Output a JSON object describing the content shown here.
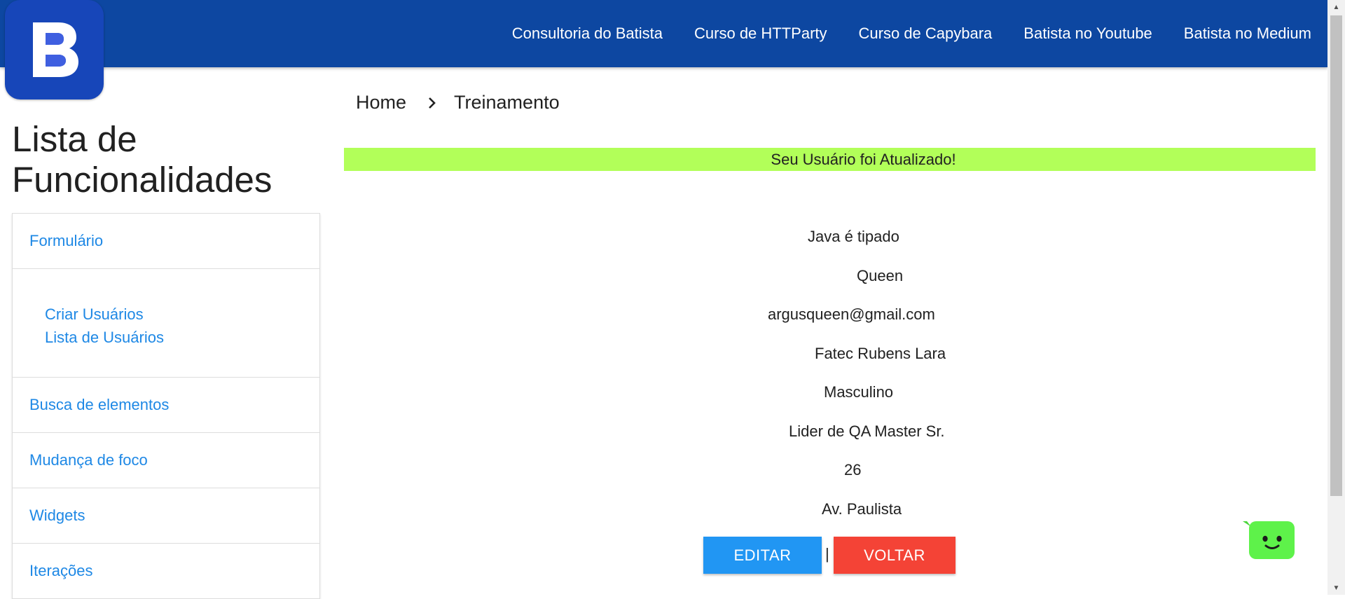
{
  "header": {
    "logo_text": "B",
    "nav_links": [
      "Consultoria do Batista",
      "Curso de HTTParty",
      "Curso de Capybara",
      "Batista no Youtube",
      "Batista no Medium"
    ]
  },
  "sidebar": {
    "title_line1": "Lista de",
    "title_line2": "Funcionalidades",
    "sections": [
      {
        "label": "Formulário",
        "items": [
          "Criar Usuários",
          "Lista de Usuários"
        ]
      },
      {
        "label": "Busca de elementos"
      },
      {
        "label": "Mudança de foco"
      },
      {
        "label": "Widgets"
      },
      {
        "label": "Iterações"
      }
    ]
  },
  "breadcrumb": {
    "home": "Home",
    "current": "Treinamento",
    "separator_icon": "chevron-right-icon"
  },
  "alert": {
    "message": "Seu Usuário foi Atualizado!",
    "color": "#b2ff59"
  },
  "user": {
    "name": "Java é tipado",
    "last_name": "Queen",
    "email": "argusqueen@gmail.com",
    "university": "Fatec Rubens Lara",
    "gender": "Masculino",
    "job": "Lider de QA Master Sr.",
    "age": "26",
    "address": "Av. Paulista"
  },
  "actions": {
    "edit_label": "EDITAR",
    "separator": "|",
    "back_label": "VOLTAR",
    "edit_color": "#2196f3",
    "back_color": "#f44336"
  },
  "chat": {
    "icon": "chat-bot-icon",
    "color": "#5ef24a"
  },
  "colors": {
    "header_bg": "#0d47a1",
    "logo_bg": "#1746b9",
    "link": "#1e88e5"
  }
}
